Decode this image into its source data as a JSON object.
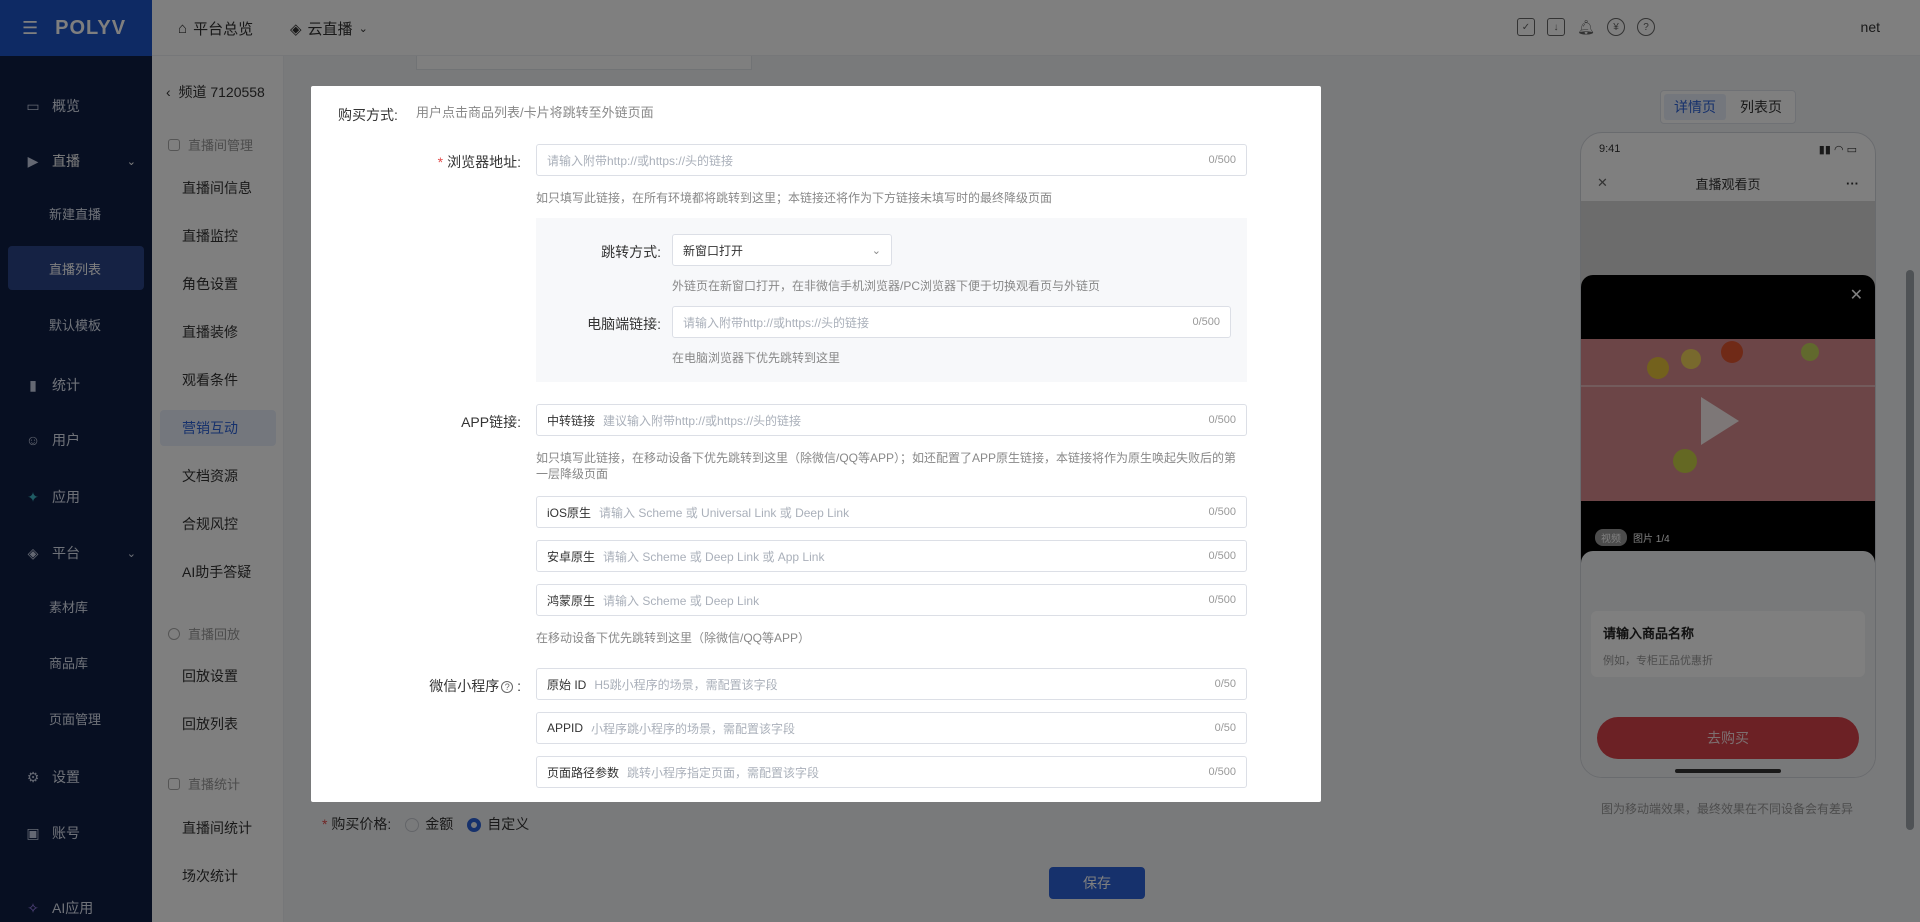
{
  "nav": {
    "logo": "POLYV",
    "items": {
      "overview": "概览",
      "live": "直播",
      "new_live": "新建直播",
      "live_list": "直播列表",
      "default_template": "默认模板",
      "stats": "统计",
      "users": "用户",
      "apps": "应用",
      "platform": "平台",
      "materials": "素材库",
      "products": "商品库",
      "pages": "页面管理",
      "settings": "设置",
      "account": "账号",
      "ai_app": "AI应用"
    }
  },
  "header": {
    "home": "平台总览",
    "cloud_live": "云直播",
    "user": "net"
  },
  "submenu": {
    "back": "频道 7120558",
    "group_room": "直播间管理",
    "room_info": "直播间信息",
    "monitor": "直播监控",
    "roles": "角色设置",
    "decor": "直播装修",
    "watch_cond": "观看条件",
    "marketing": "营销互动",
    "docs": "文档资源",
    "risk": "合规风控",
    "ai_assist": "AI助手答疑",
    "group_replay": "直播回放",
    "replay_settings": "回放设置",
    "replay_list": "回放列表",
    "group_stats": "直播统计",
    "room_stats": "直播间统计",
    "session_stats": "场次统计"
  },
  "preview": {
    "tab_detail": "详情页",
    "tab_list": "列表页",
    "time": "9:41",
    "title": "直播观看页",
    "badge_video": "视频",
    "badge_image": "图片 1/4",
    "product_name": "请输入商品名称",
    "product_desc": "例如，专柜正品优惠折",
    "buy": "去购买",
    "note": "图为移动端效果，最终效果在不同设备会有差异"
  },
  "page": {
    "price_label": "购买价格:",
    "price_amount": "金额",
    "price_custom": "自定义",
    "save": "保存"
  },
  "modal": {
    "buy_method_label": "购买方式:",
    "buy_method_desc": "用户点击商品列表/卡片将跳转至外链页面",
    "browser_label": "浏览器地址:",
    "browser_ph": "请输入附带http://或https://头的链接",
    "browser_cnt": "0/500",
    "browser_hint": "如只填写此链接，在所有环境都将跳转到这里；本链接还将作为下方链接未填写时的最终降级页面",
    "jump_label": "跳转方式:",
    "jump_value": "新窗口打开",
    "jump_hint": "外链页在新窗口打开，在非微信手机浏览器/PC浏览器下便于切换观看页与外链页",
    "pc_label": "电脑端链接:",
    "pc_ph": "请输入附带http://或https://头的链接",
    "pc_cnt": "0/500",
    "pc_hint": "在电脑浏览器下优先跳转到这里",
    "app_label": "APP链接:",
    "app_pre": "中转链接",
    "app_ph": "建议输入附带http://或https://头的链接",
    "app_cnt": "0/500",
    "app_hint": "如只填写此链接，在移动设备下优先跳转到这里（除微信/QQ等APP）；如还配置了APP原生链接，本链接将作为原生唤起失败后的第一层降级页面",
    "ios_pre": "iOS原生",
    "ios_ph": "请输入 Scheme 或 Universal Link 或 Deep Link",
    "ios_cnt": "0/500",
    "android_pre": "安卓原生",
    "android_ph": "请输入 Scheme 或 Deep Link 或 App Link",
    "android_cnt": "0/500",
    "harmony_pre": "鸿蒙原生",
    "harmony_ph": "请输入 Scheme 或 Deep Link",
    "harmony_cnt": "0/500",
    "native_hint": "在移动设备下优先跳转到这里（除微信/QQ等APP）",
    "mini_label": "微信小程序",
    "orig_pre": "原始 ID",
    "orig_ph": "H5跳小程序的场景，需配置该字段",
    "orig_cnt": "0/50",
    "appid_pre": "APPID",
    "appid_ph": "小程序跳小程序的场景，需配置该字段",
    "appid_cnt": "0/50",
    "path_pre": "页面路径参数",
    "path_ph": "跳转小程序指定页面，需配置该字段",
    "path_cnt": "0/500"
  },
  "colors": {
    "primary": "#2d63d8",
    "nav_bg": "#0f1f44",
    "logo_bg": "#1d54c8",
    "buy_button": "#d8424a",
    "required": "#e34d4d"
  }
}
